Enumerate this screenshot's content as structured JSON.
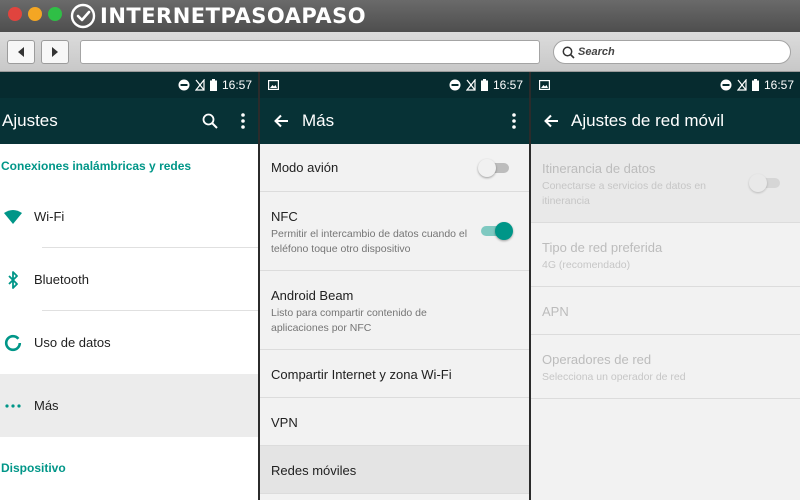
{
  "window": {
    "brand_name": "INTERNETPASOAPASO",
    "search_placeholder": "Search"
  },
  "status_bar": {
    "time": "16:57",
    "icons": [
      "notification-icon",
      "do-not-disturb-icon",
      "no-signal-icon",
      "battery-icon"
    ]
  },
  "panel_settings": {
    "title": "Ajustes",
    "section_wireless": "Conexiones inalámbricas y redes",
    "items": [
      {
        "label": "Wi-Fi",
        "icon": "wifi-icon"
      },
      {
        "label": "Bluetooth",
        "icon": "bluetooth-icon"
      },
      {
        "label": "Uso de datos",
        "icon": "data-usage-icon"
      },
      {
        "label": "Más",
        "icon": "more-dots-icon"
      }
    ],
    "section_device": "Dispositivo"
  },
  "panel_more": {
    "title": "Más",
    "items": [
      {
        "title": "Modo avión",
        "subtitle": "",
        "toggle": "off"
      },
      {
        "title": "NFC",
        "subtitle": "Permitir el intercambio de datos cuando el teléfono toque otro dispositivo",
        "toggle": "on"
      },
      {
        "title": "Android Beam",
        "subtitle": "Listo para compartir contenido de aplicaciones por NFC"
      },
      {
        "title": "Compartir Internet y zona Wi-Fi",
        "subtitle": ""
      },
      {
        "title": "VPN",
        "subtitle": ""
      },
      {
        "title": "Redes móviles",
        "subtitle": ""
      }
    ]
  },
  "panel_mobile": {
    "title": "Ajustes de red móvil",
    "items": [
      {
        "title": "Itinerancia de datos",
        "subtitle": "Conectarse a servicios de datos en itinerancia",
        "toggle": "off"
      },
      {
        "title": "Tipo de red preferida",
        "subtitle": "4G (recomendado)"
      },
      {
        "title": "APN",
        "subtitle": ""
      },
      {
        "title": "Operadores de red",
        "subtitle": "Selecciona un operador de red"
      }
    ]
  },
  "colors": {
    "accent": "#009688",
    "app_bar": "#073236",
    "status_bar": "#062b2f"
  }
}
